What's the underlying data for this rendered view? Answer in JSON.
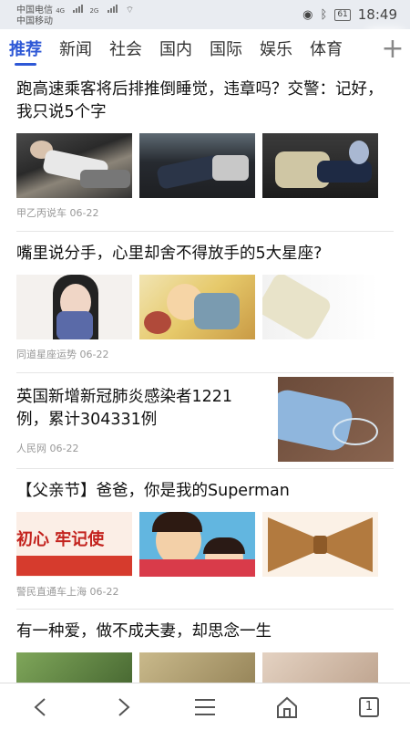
{
  "status": {
    "carrier1": "中国电信",
    "carrier2": "中国移动",
    "net1": "4G",
    "net2": "2G",
    "battery": "61",
    "time": "18:49"
  },
  "tabs": [
    "推荐",
    "新闻",
    "社会",
    "国内",
    "国际",
    "娱乐",
    "体育"
  ],
  "plus": "+",
  "feed": [
    {
      "title": "跑高速乘客将后排推倒睡觉，违章吗？交警：记好，我只说5个字",
      "source": "甲乙丙说车 06-22"
    },
    {
      "title": "嘴里说分手，心里却舍不得放手的5大星座?",
      "source": "同道星座运势 06-22"
    },
    {
      "title": "英国新增新冠肺炎感染者1221例，累计304331例",
      "source": "人民网 06-22"
    },
    {
      "title": "【父亲节】爸爸，你是我的Superman",
      "source": "警民直通车上海 06-22"
    },
    {
      "title": "有一种爱，做不成夫妻，却思念一生",
      "source": ""
    }
  ],
  "banner_text": "初心 牢记使",
  "nav": {
    "tabs_count": "1"
  },
  "colors": {
    "accent": "#2e58d6"
  },
  "icons": [
    "back-icon",
    "forward-icon",
    "menu-icon",
    "home-icon",
    "tabs-icon"
  ]
}
